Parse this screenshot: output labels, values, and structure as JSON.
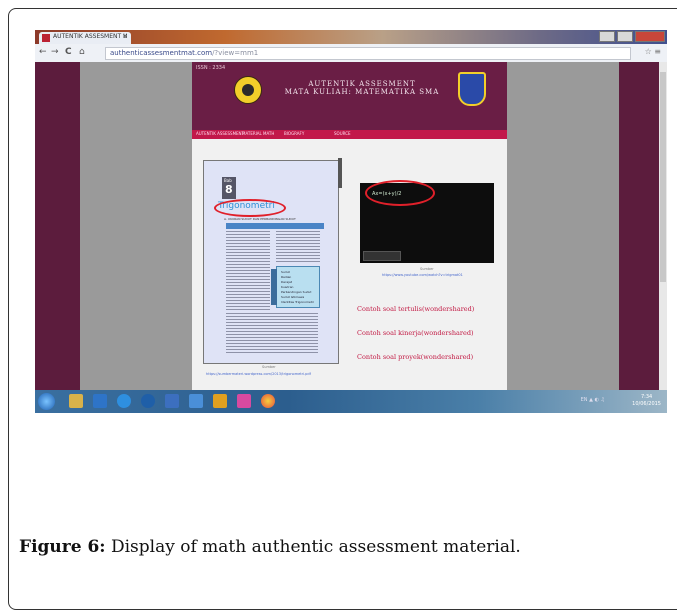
{
  "browser": {
    "tab_title": "AUTENTIK ASSESMENT U",
    "tab_close": "×",
    "url_domain": "authenticassesmentmat.com",
    "url_path": "/?view=mm1",
    "back": "←",
    "forward": "→",
    "reload": "C",
    "home": "⌂"
  },
  "site": {
    "tag": "ISSN : 2334",
    "title_line1": "AUTENTIK ASSESMENT",
    "title_line2": "MATA KULIAH: MATEMATIKA SMA",
    "menu": [
      "AUTENTIK ASSESSMENT",
      "MATERIAL MATH",
      "BIOGRAFY",
      "SOURCE"
    ],
    "book": {
      "bab_label": "Bab",
      "bab_number": "8",
      "chapter_title": "Trigonometri",
      "subheading": "A. UKURAN SUDUT DAN PERBANDINGAN SUDUT",
      "box_items": [
        "Sudut",
        "Radian",
        "Derajat",
        "Kuadran",
        "Perbandingan Sudut",
        "Sudut Istimewa",
        "Identitas Trigonometri"
      ]
    },
    "book_source_label": "Sumber",
    "book_source_url": "https://sumbermateri.wordpress.com/2013/trigonometri.pdf",
    "video": {
      "overlay_text": "Ax=(x+y)/2"
    },
    "video_source_label": "Sumber",
    "video_source_url": "https://www.youtube.com/watch?v=trigmat01",
    "links": [
      "Contoh soal tertulis(wondershared)",
      "Contoh soal kinerja(wondershared)",
      "Contoh soal proyek(wondershared)"
    ]
  },
  "taskbar": {
    "tray_text": "EN ▲ ◐ ♫",
    "time": "7:34",
    "date": "10/06/2015"
  },
  "caption": {
    "label": "Figure 6:",
    "text": " Display of math authentic assessment material."
  },
  "colors": {
    "maroon": "#6a1e45",
    "menu_red": "#c2184a",
    "link_red": "#c21a44",
    "annotation_red": "#e0202a"
  }
}
